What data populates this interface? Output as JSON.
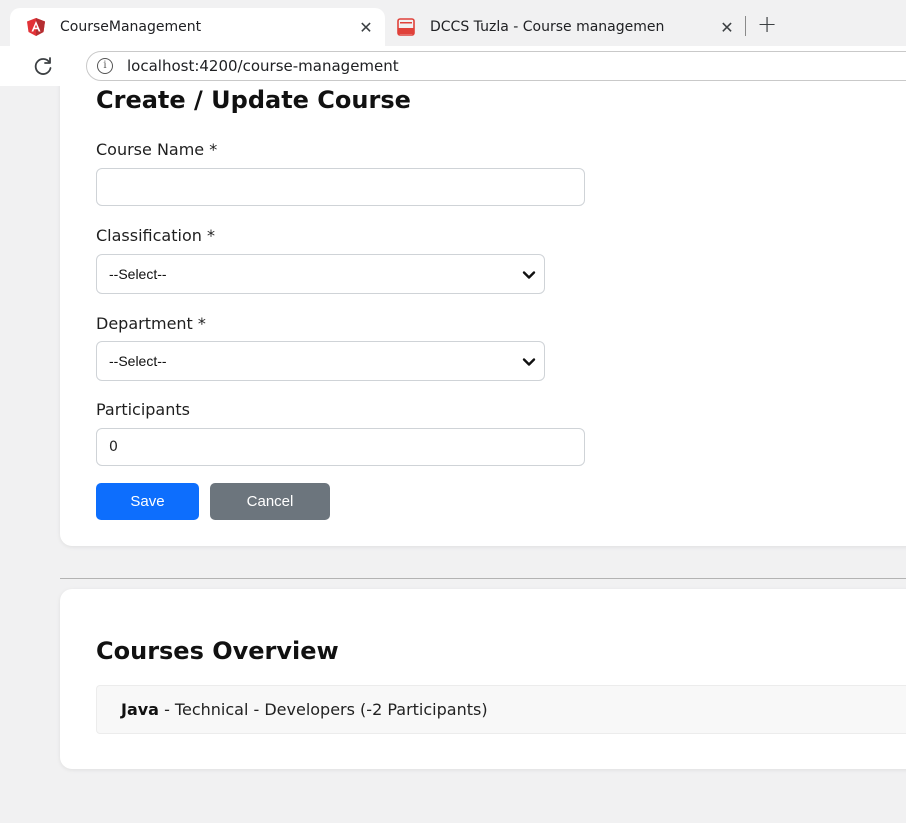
{
  "browser": {
    "tabs": [
      {
        "title": "CourseManagement",
        "icon": "angular-icon",
        "active": true
      },
      {
        "title": "DCCS Tuzla - Course managemen",
        "icon": "pdf-icon",
        "active": false
      }
    ],
    "close_glyph": "✕",
    "new_tab_glyph": "+",
    "url": "localhost:4200/course-management"
  },
  "form": {
    "title": "Create / Update Course",
    "course_name_label": "Course Name *",
    "course_name_value": "",
    "classification_label": "Classification *",
    "classification_selected": "--Select--",
    "department_label": "Department *",
    "department_selected": "--Select--",
    "participants_label": "Participants",
    "participants_value": "0",
    "save_label": "Save",
    "cancel_label": "Cancel"
  },
  "overview": {
    "title": "Courses Overview",
    "courses": [
      {
        "name": "Java",
        "details": " - Technical - Developers (-2 Participants)"
      }
    ]
  },
  "colors": {
    "primary": "#0d6efd",
    "secondary": "#6c757d"
  }
}
